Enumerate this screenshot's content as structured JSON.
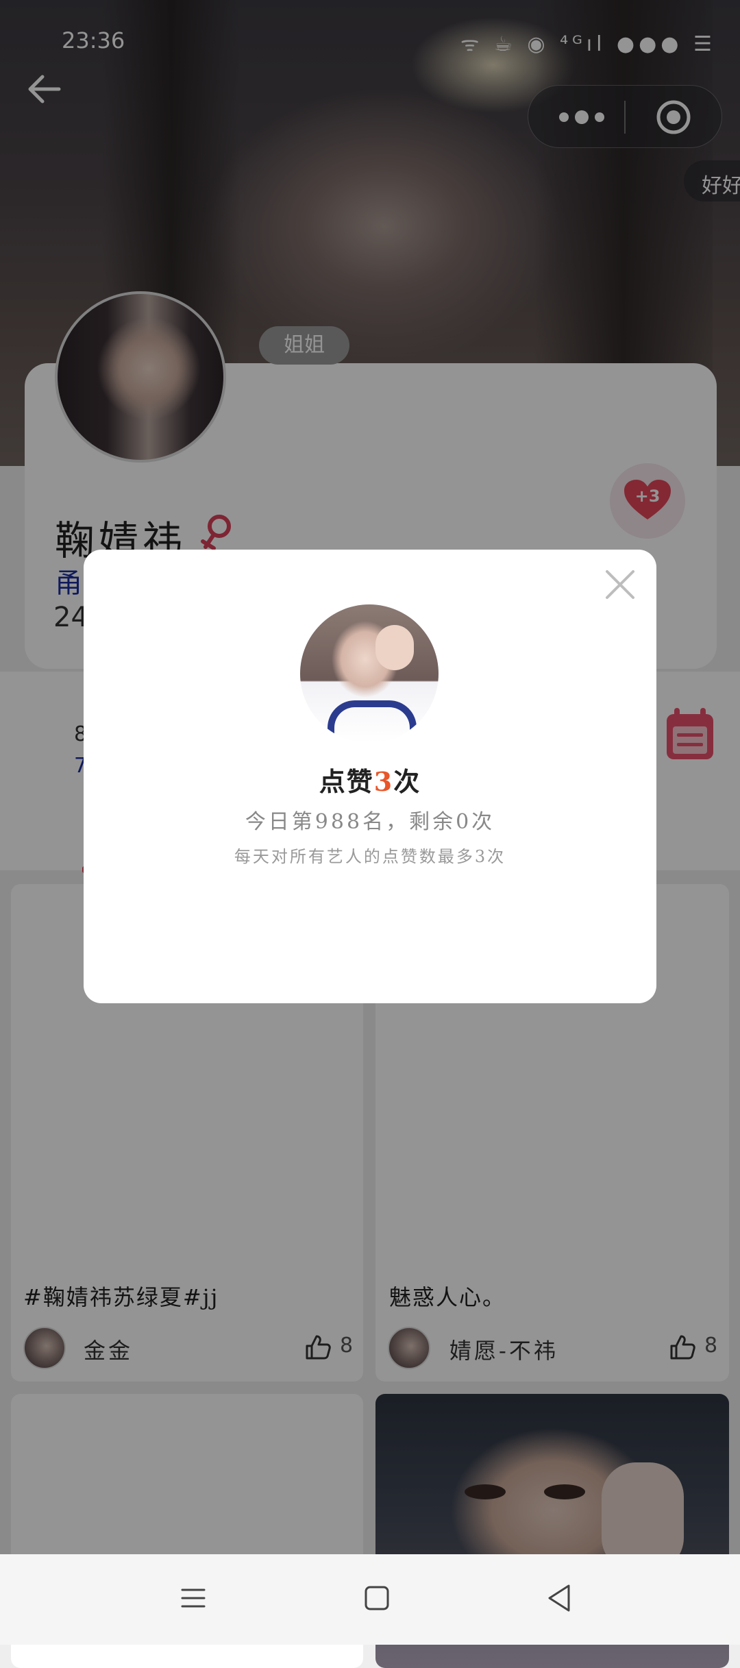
{
  "status_bar": {
    "time": "23:36",
    "icons_text": "ᯤ ☕ ◉ ⁴ᴳıl ●●● ☰"
  },
  "header": {
    "chip": "好好"
  },
  "profile": {
    "tag": "姐姐",
    "name": "鞠婧祎",
    "subline": "甬",
    "age_prefix": "24",
    "like_bonus": "+3"
  },
  "stats": {
    "line1": "8",
    "line2": "7"
  },
  "feed": [
    {
      "title": "#鞠婧祎苏绿夏#jj",
      "user": "金金",
      "likes": "8"
    },
    {
      "title": "魅惑人心。",
      "user": "婧愿-不祎",
      "likes": "8"
    }
  ],
  "modal": {
    "likes_prefix": "点赞",
    "likes_count": "3",
    "likes_suffix": "次",
    "rank_text": "今日第988名，剩余0次",
    "rule_text": "每天对所有艺人的点赞数最多3次"
  },
  "colors": {
    "accent": "#e8562a",
    "brand_pink": "#e3455a",
    "link_blue": "#1a2ea0"
  }
}
